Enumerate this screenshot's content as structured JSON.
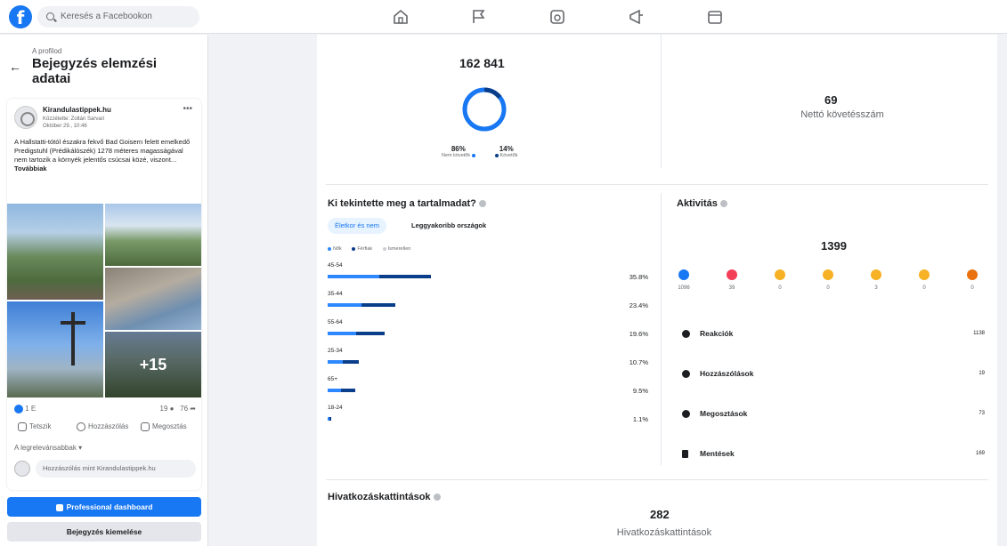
{
  "header": {
    "search_placeholder": "Keresés a Facebookon",
    "logo": "f"
  },
  "left": {
    "breadcrumb": "A profilod",
    "title": "Bejegyzés elemzési adatai",
    "post": {
      "page_name": "Kirandulastippek.hu",
      "meta_line1": "Közzétette: Zoltán Sarvari",
      "meta_line2": "Október 29., 10:46",
      "text": "A Hallstatti-tótól északra fekvő Bad Goisern felett emelkedő Predigstuhl (Prédikálószék) 1278 méteres magasságával nem tartozik a környék jelentős csúcsai közé, viszont...",
      "more": "Továbbiak",
      "photo_more": "+15",
      "reactions": "1 E",
      "comments_count": "19",
      "shares_count": "76",
      "actions": {
        "like": "Tetszik",
        "comment": "Hozzászólás",
        "share": "Megosztás"
      },
      "sort": "A legrelevánsabbak",
      "comment_placeholder": "Hozzászólás mint Kirandulastippek.hu"
    },
    "pro_dashboard": "Professional dashboard",
    "boost": "Bejegyzés kiemelése"
  },
  "main": {
    "reach": {
      "value": "162 841",
      "nonfollowers_pct": "86%",
      "followers_pct": "14%",
      "nonfollowers_label": "Nem követők",
      "followers_label": "Követők"
    },
    "net_follows": {
      "value": "69",
      "label": "Nettó követésszám"
    },
    "audience": {
      "title": "Ki tekintette meg a tartalmadat?",
      "tab_active": "Életkor és nem",
      "tab_other": "Leggyakoribb országok",
      "legend": {
        "women": "Nők",
        "men": "Férfiak",
        "unknown": "Ismeretlen"
      },
      "rows": [
        {
          "label": "45-54",
          "pct": "35.8%",
          "total": 35.8,
          "women": 0.5
        },
        {
          "label": "35-44",
          "pct": "23.4%",
          "total": 23.4,
          "women": 0.5
        },
        {
          "label": "55-64",
          "pct": "19.6%",
          "total": 19.6,
          "women": 0.5
        },
        {
          "label": "25-34",
          "pct": "10.7%",
          "total": 10.7,
          "women": 0.5
        },
        {
          "label": "65+",
          "pct": "9.5%",
          "total": 9.5,
          "women": 0.5
        },
        {
          "label": "18-24",
          "pct": "1.1%",
          "total": 1.1,
          "women": 0.5
        }
      ]
    },
    "activity": {
      "title": "Aktivitás",
      "total": "1399",
      "reactions": [
        {
          "icon": "like-icon",
          "color": "#1877f2",
          "count": "1096"
        },
        {
          "icon": "love-icon",
          "color": "#f33e58",
          "count": "39"
        },
        {
          "icon": "care-icon",
          "color": "#f7b125",
          "count": "0"
        },
        {
          "icon": "haha-icon",
          "color": "#f7b125",
          "count": "0"
        },
        {
          "icon": "wow-icon",
          "color": "#f7b125",
          "count": "3"
        },
        {
          "icon": "sad-icon",
          "color": "#f7b125",
          "count": "0"
        },
        {
          "icon": "angry-icon",
          "color": "#e9710f",
          "count": "0"
        }
      ],
      "rows": [
        {
          "label": "Reakciók",
          "value": "1138"
        },
        {
          "label": "Hozzászólások",
          "value": "19"
        },
        {
          "label": "Megosztások",
          "value": "73"
        },
        {
          "label": "Mentések",
          "value": "169"
        }
      ]
    },
    "link_clicks": {
      "title": "Hivatkozáskattintások",
      "value": "282",
      "label": "Hivatkozáskattintások"
    }
  },
  "colors": {
    "accent": "#1877f2",
    "dark_blue": "#0a3e8a"
  }
}
